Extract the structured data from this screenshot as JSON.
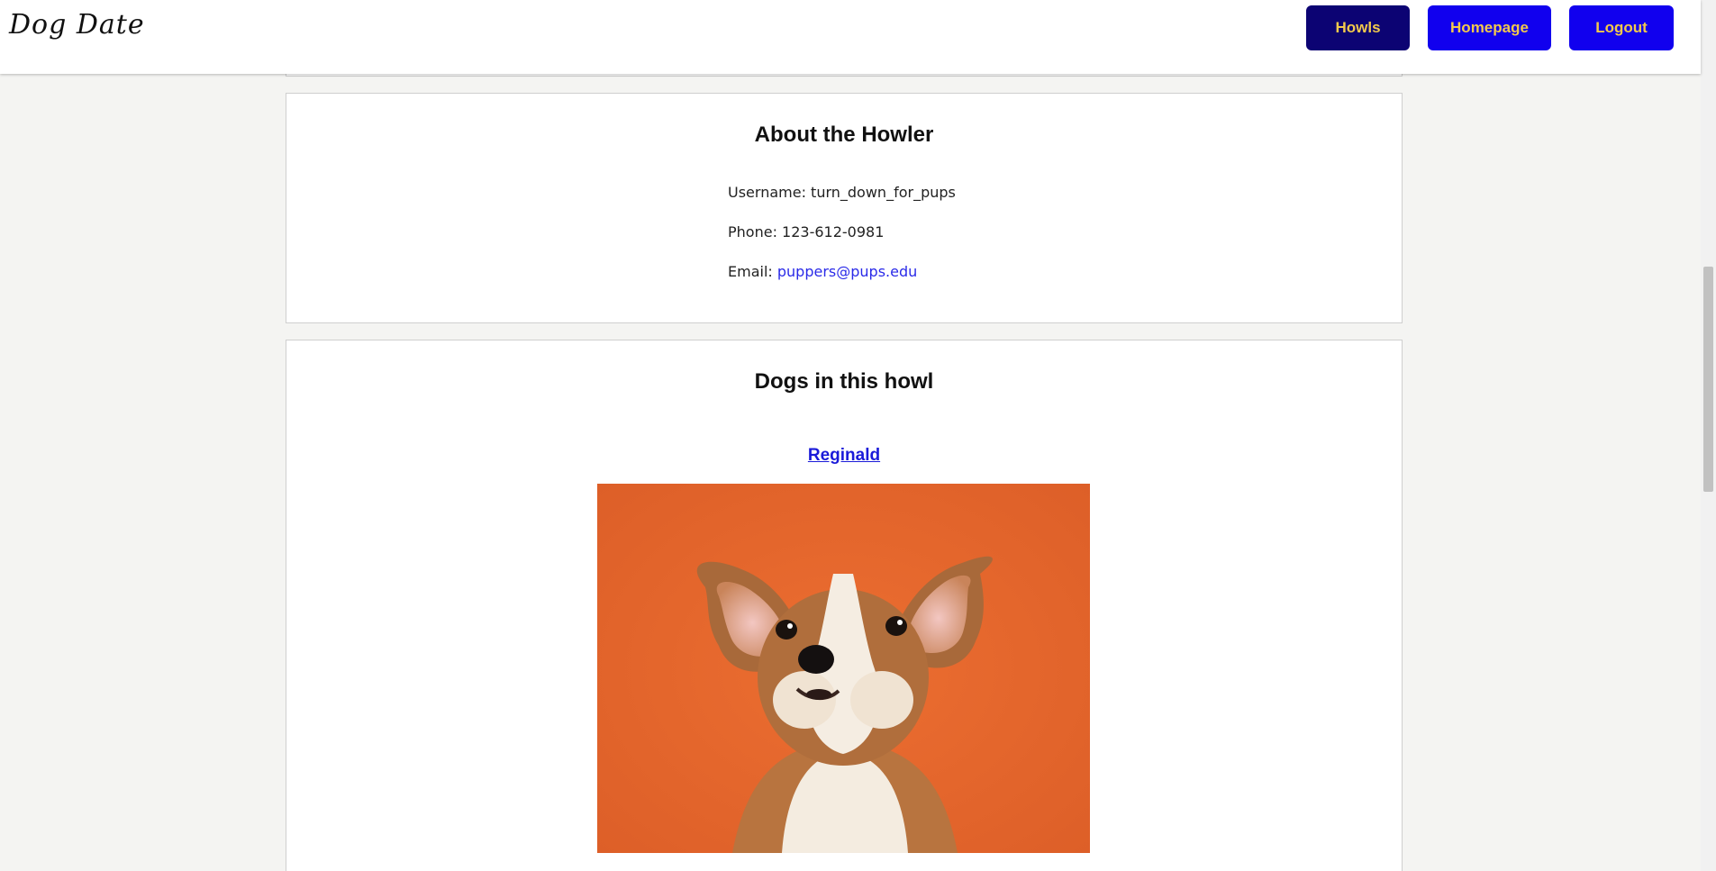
{
  "header": {
    "brand": "Dog Date",
    "nav": {
      "howls": "Howls",
      "homepage": "Homepage",
      "logout": "Logout"
    },
    "colors": {
      "howls_bg": "#0c0373",
      "nav_bg": "#1100ee",
      "nav_text": "#f2c94c"
    }
  },
  "about": {
    "title": "About the Howler",
    "username_label": "Username: ",
    "username": "turn_down_for_pups",
    "phone_label": "Phone: ",
    "phone": "123-612-0981",
    "email_label": "Email: ",
    "email": "puppers@pups.edu"
  },
  "dogs": {
    "title": "Dogs in this howl",
    "items": [
      {
        "name": "Reginald",
        "photo": "corgi-puppy-orange-background"
      }
    ]
  }
}
